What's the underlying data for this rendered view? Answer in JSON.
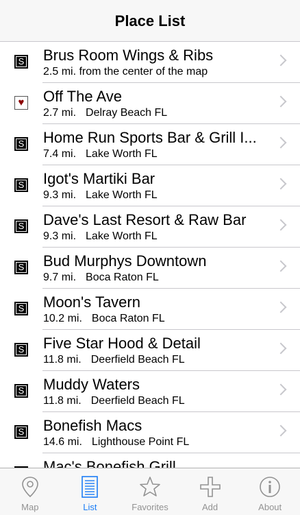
{
  "header": {
    "title": "Place List"
  },
  "places": [
    {
      "icon": "S",
      "name": "Brus Room Wings & Ribs",
      "distance": "2.5 mi. from the center of the map",
      "location": ""
    },
    {
      "icon": "heart",
      "name": "Off The Ave",
      "distance": "2.7 mi.",
      "location": "Delray Beach FL"
    },
    {
      "icon": "S",
      "name": "Home Run Sports Bar & Grill I...",
      "distance": "7.4 mi.",
      "location": "Lake Worth FL"
    },
    {
      "icon": "S",
      "name": "Igot's Martiki Bar",
      "distance": "9.3 mi.",
      "location": "Lake Worth FL"
    },
    {
      "icon": "S",
      "name": "Dave's Last Resort & Raw Bar",
      "distance": "9.3 mi.",
      "location": "Lake Worth FL"
    },
    {
      "icon": "S",
      "name": "Bud Murphys Downtown",
      "distance": "9.7 mi.",
      "location": "Boca Raton FL"
    },
    {
      "icon": "S",
      "name": "Moon's Tavern",
      "distance": "10.2 mi.",
      "location": "Boca Raton FL"
    },
    {
      "icon": "S",
      "name": "Five Star Hood & Detail",
      "distance": "11.8 mi.",
      "location": "Deerfield Beach FL"
    },
    {
      "icon": "S",
      "name": "Muddy Waters",
      "distance": "11.8 mi.",
      "location": "Deerfield Beach FL"
    },
    {
      "icon": "S",
      "name": "Bonefish Macs",
      "distance": "14.6 mi.",
      "location": "Lighthouse Point FL"
    },
    {
      "icon": "S",
      "name": "Mac's Bonefish Grill",
      "distance": "",
      "location": ""
    }
  ],
  "tabs": [
    {
      "label": "Map",
      "icon": "map-pin-icon",
      "active": false
    },
    {
      "label": "List",
      "icon": "list-icon",
      "active": true
    },
    {
      "label": "Favorites",
      "icon": "star-icon",
      "active": false
    },
    {
      "label": "Add",
      "icon": "plus-icon",
      "active": false
    },
    {
      "label": "About",
      "icon": "info-icon",
      "active": false
    }
  ],
  "colors": {
    "accent": "#1a7cf5",
    "inactive": "#929292",
    "heart": "#8b0000"
  }
}
